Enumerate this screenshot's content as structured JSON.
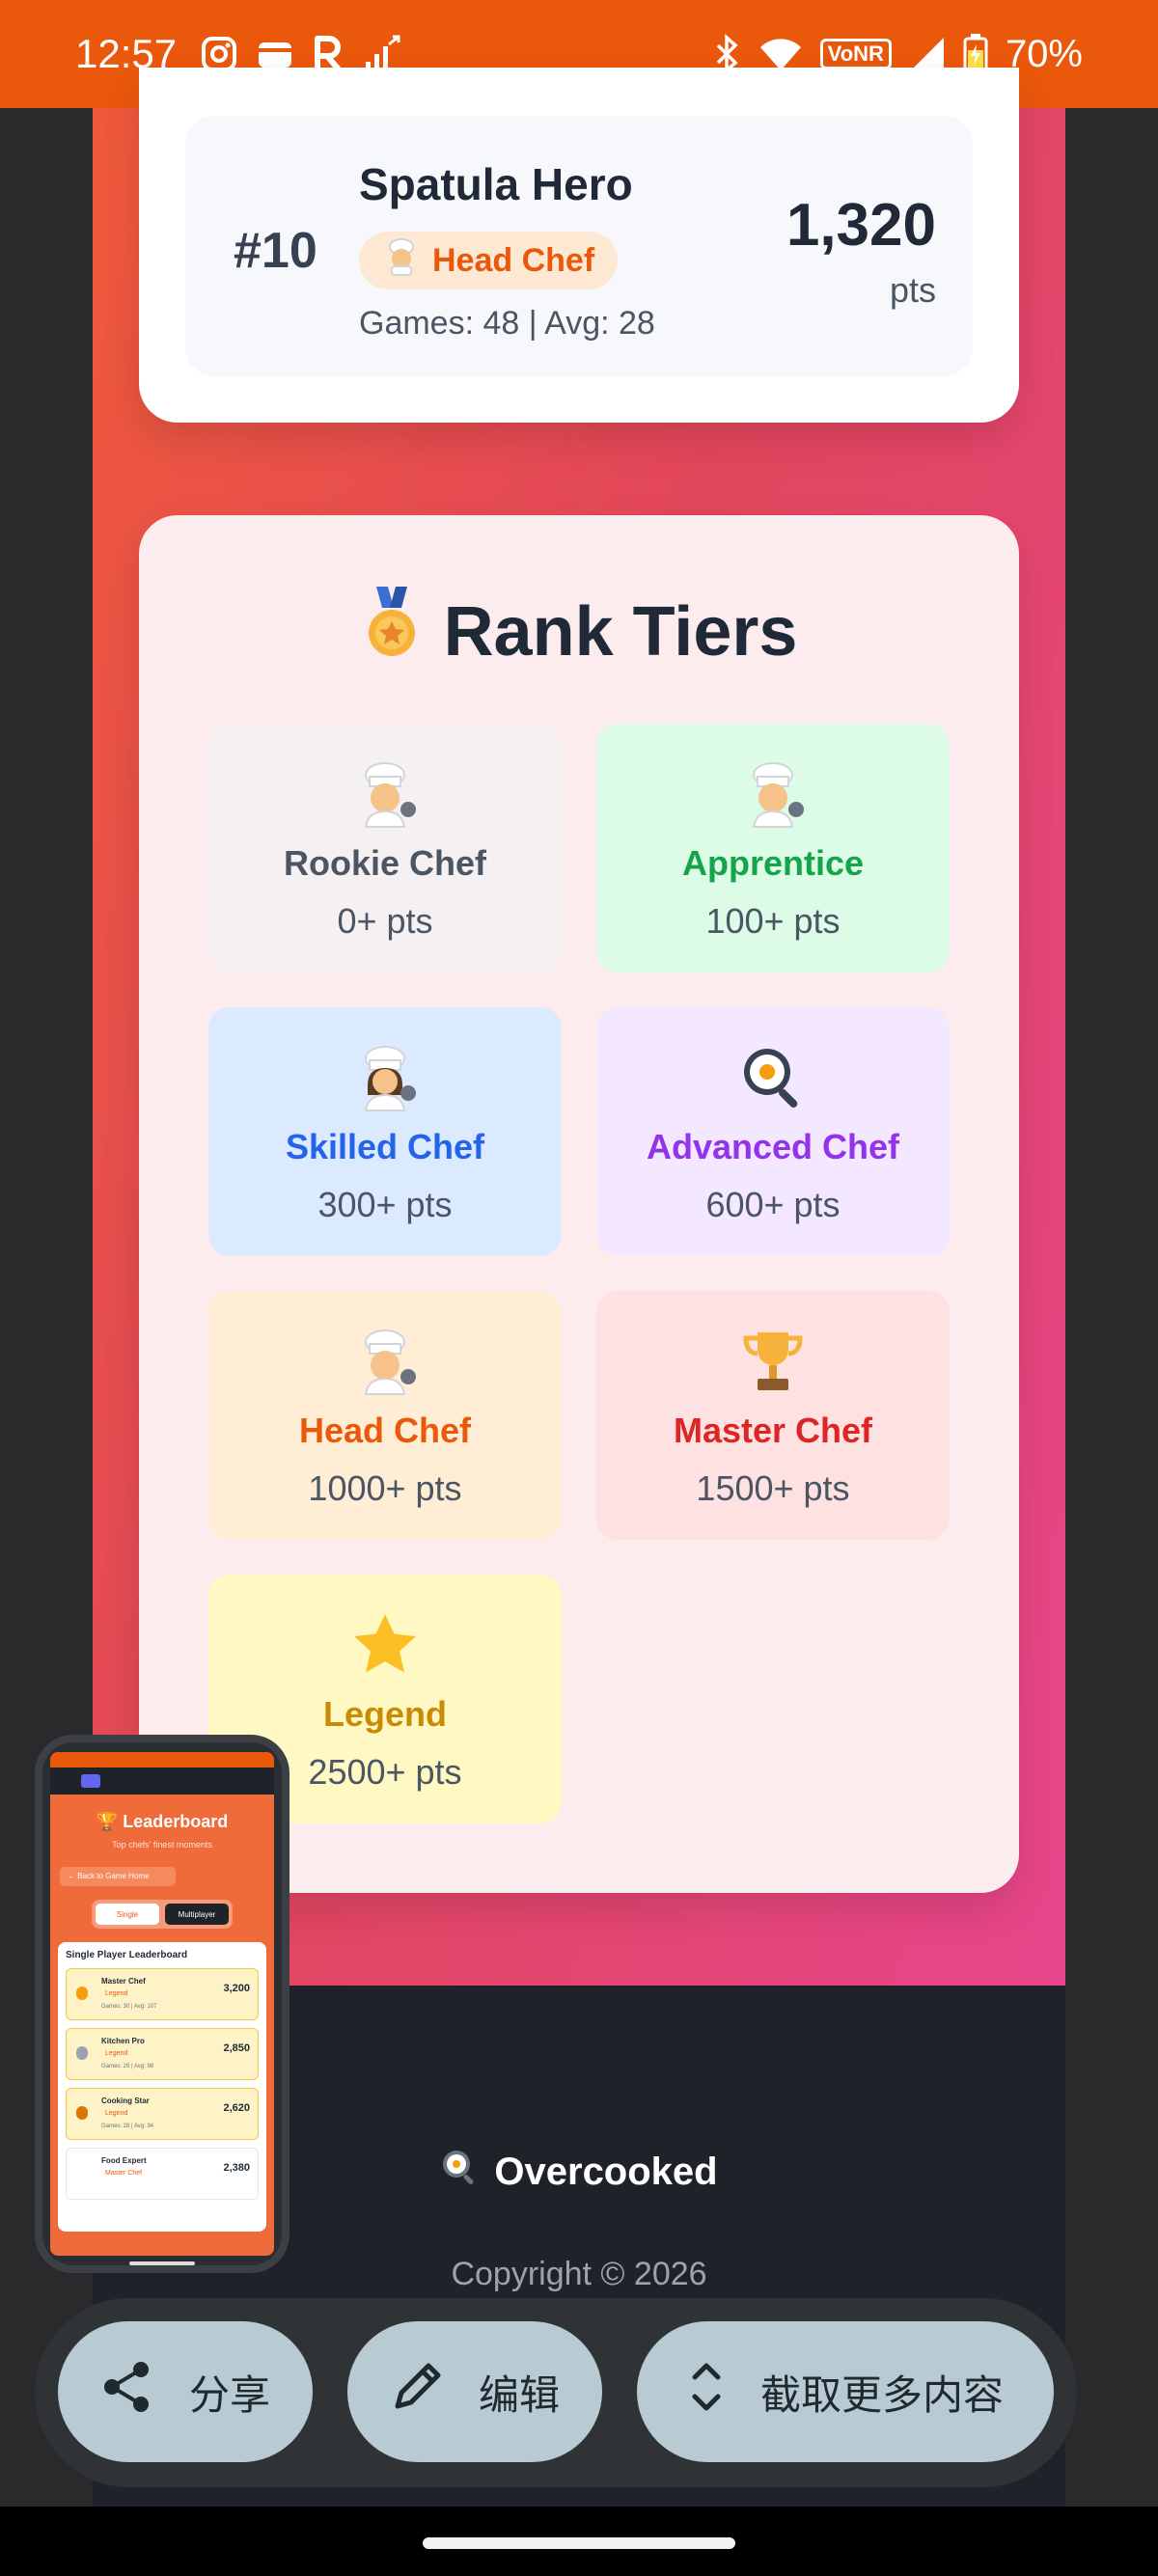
{
  "status_bar": {
    "time": "12:57",
    "battery": "70%",
    "network_badge": "VoNR",
    "left_icons": [
      "instagram-icon",
      "wallet-icon",
      "r-app-icon",
      "signal-boost-icon"
    ],
    "right_icons": [
      "bluetooth-icon",
      "wifi-icon",
      "cell-signal-icon",
      "battery-icon"
    ]
  },
  "player_entry": {
    "rank": "#10",
    "name": "Spatula Hero",
    "badge": "Head Chef",
    "stats": "Games: 48 | Avg: 28",
    "score": "1,320",
    "score_unit": "pts"
  },
  "rank_tiers": {
    "title": "Rank Tiers",
    "tiers": [
      {
        "name": "Rookie Chef",
        "points": "0+ pts",
        "icon": "chef-icon",
        "color": "#4b5563",
        "bg": "#f5f1f2"
      },
      {
        "name": "Apprentice",
        "points": "100+ pts",
        "icon": "chef-icon",
        "color": "#16a34a",
        "bg": "#dcfce7"
      },
      {
        "name": "Skilled Chef",
        "points": "300+ pts",
        "icon": "woman-chef-icon",
        "color": "#2563eb",
        "bg": "#dbeafe"
      },
      {
        "name": "Advanced Chef",
        "points": "600+ pts",
        "icon": "frying-pan-icon",
        "color": "#9333ea",
        "bg": "#f3e8ff"
      },
      {
        "name": "Head Chef",
        "points": "1000+ pts",
        "icon": "chef-icon",
        "color": "#ea580c",
        "bg": "#ffedd5"
      },
      {
        "name": "Master Chef",
        "points": "1500+ pts",
        "icon": "trophy-icon",
        "color": "#dc2626",
        "bg": "#fee2e2"
      },
      {
        "name": "Legend",
        "points": "2500+ pts",
        "icon": "star-icon",
        "color": "#ca8a04",
        "bg": "#fef9c3"
      }
    ]
  },
  "footer": {
    "brand": "Overcooked",
    "copyright": "Copyright © 2026"
  },
  "screenshot_toolbar": {
    "share": "分享",
    "edit": "编辑",
    "scroll_capture": "截取更多内容"
  },
  "thumbnail": {
    "title": "Leaderboard",
    "subtitle": "Top chefs' finest moments",
    "back": "← Back to Game Home",
    "single": "Single",
    "multiplayer": "Multiplayer",
    "panel_title": "Single Player Leaderboard",
    "rows": [
      {
        "name": "Master Chef",
        "badge": "Legend",
        "stats": "Games: 30 | Avg: 107",
        "score": "3,200"
      },
      {
        "name": "Kitchen Pro",
        "badge": "Legend",
        "stats": "Games: 29 | Avg: 98",
        "score": "2,850"
      },
      {
        "name": "Cooking Star",
        "badge": "Legend",
        "stats": "Games: 28 | Avg: 94",
        "score": "2,620"
      },
      {
        "name": "Food Expert",
        "badge": "Master Chef",
        "stats": "",
        "score": "2,380"
      }
    ]
  },
  "colors": {
    "accent": "#ea580c",
    "page_gradient_start": "#ef5a3a",
    "page_gradient_end": "#e8458c",
    "footer_bg": "#1f2228"
  }
}
